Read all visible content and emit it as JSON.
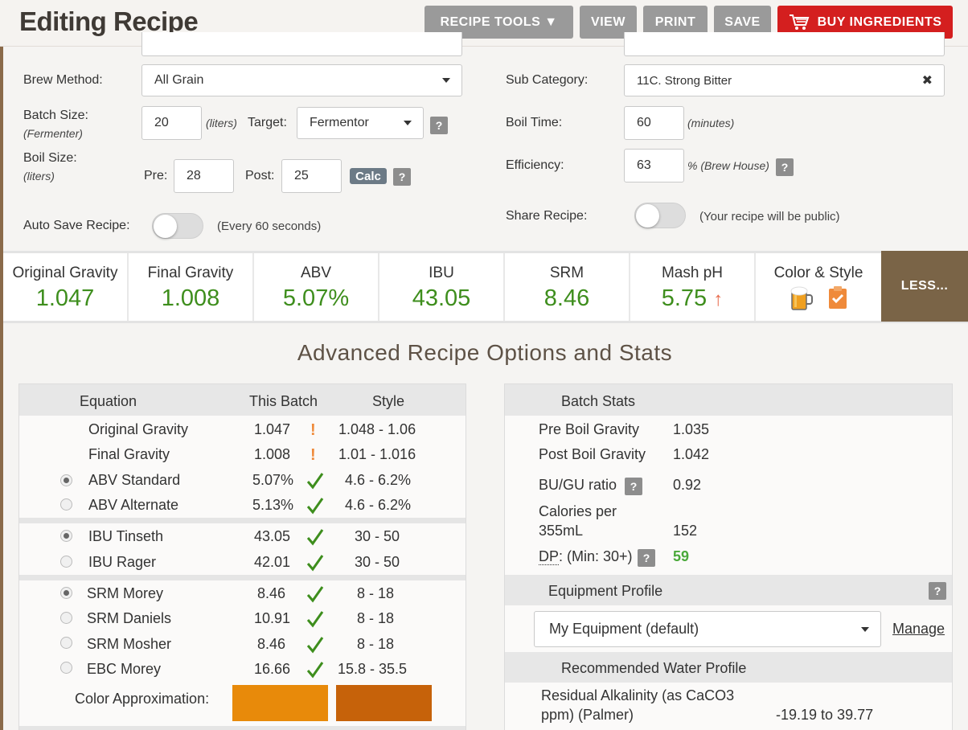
{
  "header": {
    "title": "Editing Recipe",
    "recipe_tools": "RECIPE TOOLS ▼",
    "view": "VIEW",
    "print": "PRINT",
    "save": "SAVE",
    "buy": "BUY INGREDIENTS"
  },
  "form": {
    "brew_method_label": "Brew Method:",
    "brew_method_value": "All Grain",
    "batch_size_label": "Batch Size:",
    "batch_size_sub": "(Fermenter)",
    "batch_size_value": "20",
    "batch_size_unit": "(liters)",
    "target_label": "Target:",
    "target_value": "Fermentor",
    "boil_size_label": "Boil Size:",
    "boil_size_sub": "(liters)",
    "pre_label": "Pre:",
    "pre_value": "28",
    "post_label": "Post:",
    "post_value": "25",
    "calc": "Calc",
    "auto_save_label": "Auto Save Recipe:",
    "auto_save_note": "(Every 60 seconds)",
    "sub_category_label": "Sub Category:",
    "sub_category_value": "11C. Strong Bitter",
    "boil_time_label": "Boil Time:",
    "boil_time_value": "60",
    "boil_time_unit": "(minutes)",
    "efficiency_label": "Efficiency:",
    "efficiency_value": "63",
    "efficiency_unit": "% (Brew House)",
    "share_label": "Share Recipe:",
    "share_note": "(Your recipe will be public)",
    "help": "?"
  },
  "stats": [
    {
      "label": "Original Gravity",
      "value": "1.047"
    },
    {
      "label": "Final Gravity",
      "value": "1.008"
    },
    {
      "label": "ABV",
      "value": "5.07%"
    },
    {
      "label": "IBU",
      "value": "43.05"
    },
    {
      "label": "SRM",
      "value": "8.46"
    },
    {
      "label": "Mash pH",
      "value": "5.75",
      "arrow": "↑"
    },
    {
      "label": "Color & Style"
    }
  ],
  "less_button": "LESS...",
  "section_title": "Advanced Recipe Options and Stats",
  "equation_table": {
    "headers": [
      "Equation",
      "This Batch",
      "Style"
    ],
    "rows": [
      {
        "name": "Original Gravity",
        "batch": "1.047",
        "style": "1.048 - 1.06",
        "status": "!"
      },
      {
        "name": "Final Gravity",
        "batch": "1.008",
        "style": "1.01 - 1.016",
        "status": "!"
      },
      {
        "name": "ABV Standard",
        "batch": "5.07%",
        "style": "4.6 - 6.2%",
        "status": "ok",
        "radio": "on"
      },
      {
        "name": "ABV Alternate",
        "batch": "5.13%",
        "style": "4.6 - 6.2%",
        "status": "ok",
        "radio": "off"
      },
      {
        "name": "IBU Tinseth",
        "batch": "43.05",
        "style": "30 - 50",
        "status": "ok",
        "radio": "on"
      },
      {
        "name": "IBU Rager",
        "batch": "42.01",
        "style": "30 - 50",
        "status": "ok",
        "radio": "off"
      },
      {
        "name": "SRM Morey",
        "batch": "8.46",
        "style": "8 - 18",
        "status": "ok",
        "radio": "on"
      },
      {
        "name": "SRM Daniels",
        "batch": "10.91",
        "style": "8 - 18",
        "status": "ok",
        "radio": "off"
      },
      {
        "name": "SRM Mosher",
        "batch": "8.46",
        "style": "8 - 18",
        "status": "ok",
        "radio": "off"
      },
      {
        "name": "EBC Morey",
        "batch": "16.66",
        "style": "15.8 - 35.5",
        "status": "ok",
        "radio": "off"
      }
    ],
    "color_label": "Color Approximation:",
    "swatch_batch": "#e88a0a",
    "swatch_style": "#c6620a"
  },
  "batch_stats": {
    "title": "Batch Stats",
    "pre_boil_label": "Pre Boil Gravity",
    "pre_boil_value": "1.035",
    "post_boil_label": "Post Boil Gravity",
    "post_boil_value": "1.042",
    "bugu_label": "BU/GU ratio",
    "bugu_value": "0.92",
    "calories_label_1": "Calories per",
    "calories_label_2": "355mL",
    "calories_value": "152",
    "dp_abbr": "DP",
    "dp_label": ": (Min: 30+)",
    "dp_value": "59"
  },
  "equipment": {
    "title": "Equipment Profile",
    "selected": "My Equipment (default)",
    "manage": "Manage"
  },
  "water": {
    "title": "Recommended Water Profile",
    "ra_label_1": "Residual Alkalinity (as CaCO3",
    "ra_label_2": "ppm) (Palmer)",
    "ra_value": "-19.19 to 39.77"
  }
}
